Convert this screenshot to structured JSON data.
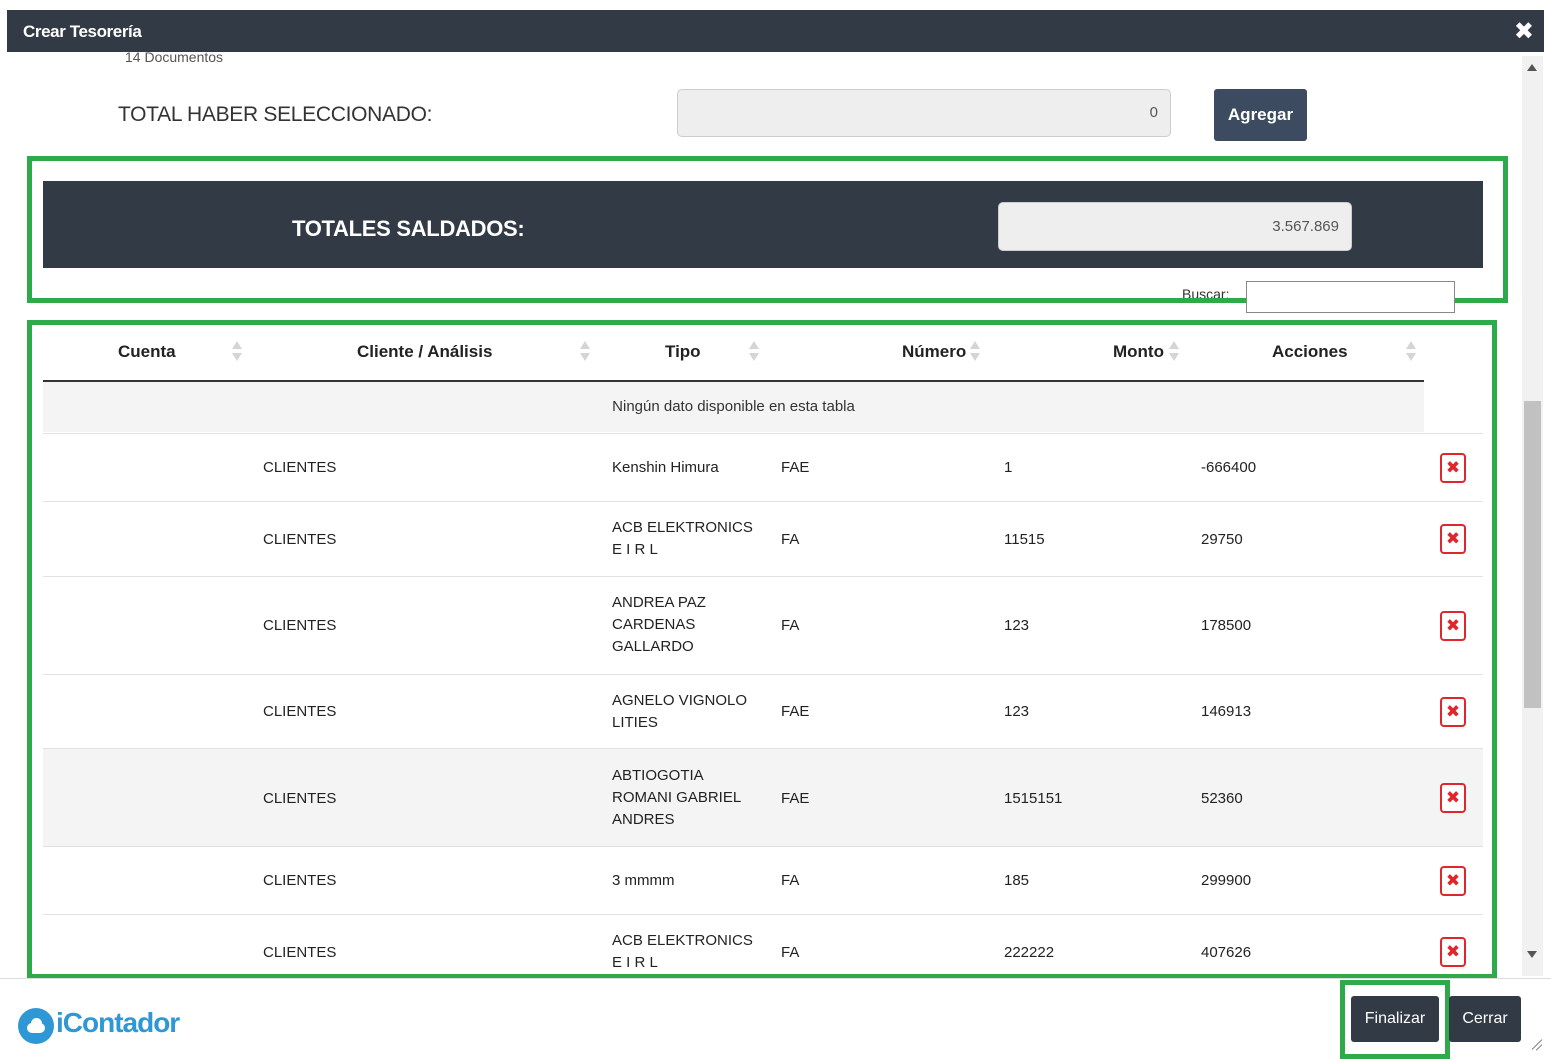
{
  "window": {
    "title": "Crear Tesorería",
    "close_glyph": "✖"
  },
  "summary": {
    "documents_count": "14 Documentos",
    "total_haber_label": "TOTAL HABER SELECCIONADO:",
    "total_haber_value": "0",
    "add_button": "Agregar"
  },
  "totals": {
    "label": "TOTALES SALDADOS:",
    "value": "3.567.869"
  },
  "search": {
    "label": "Buscar:",
    "value": ""
  },
  "table": {
    "columns": [
      "Cuenta",
      "Cliente / Análisis",
      "Tipo",
      "Número",
      "Monto",
      "Acciones"
    ],
    "empty_message": "Ningún dato disponible en esta tabla",
    "delete_glyph": "✖",
    "rows": [
      {
        "cuenta": "CLIENTES",
        "cliente": "Kenshin Himura",
        "tipo": "FAE",
        "numero": "1",
        "monto": "-666400"
      },
      {
        "cuenta": "CLIENTES",
        "cliente": "ACB ELEKTRONICS E I R L",
        "tipo": "FA",
        "numero": "11515",
        "monto": "29750"
      },
      {
        "cuenta": "CLIENTES",
        "cliente": "ANDREA PAZ CARDENAS GALLARDO",
        "tipo": "FA",
        "numero": "123",
        "monto": "178500"
      },
      {
        "cuenta": "CLIENTES",
        "cliente": "AGNELO VIGNOLO LITIES",
        "tipo": "FAE",
        "numero": "123",
        "monto": "146913"
      },
      {
        "cuenta": "CLIENTES",
        "cliente": "ABTIOGOTIA ROMANI GABRIEL ANDRES",
        "tipo": "FAE",
        "numero": "1515151",
        "monto": "52360"
      },
      {
        "cuenta": "CLIENTES",
        "cliente": "3 mmmm",
        "tipo": "FA",
        "numero": "185",
        "monto": "299900"
      },
      {
        "cuenta": "CLIENTES",
        "cliente": "ACB ELEKTRONICS E I R L",
        "tipo": "FA",
        "numero": "222222",
        "monto": "407626"
      }
    ]
  },
  "footer": {
    "logo_text": "iContador",
    "finalize_button": "Finalizar",
    "close_button": "Cerrar"
  },
  "colors": {
    "header_bg": "#323a45",
    "highlight": "#2eaa4a",
    "delete_red": "#e0262d",
    "logo_blue": "#2f98d4"
  }
}
